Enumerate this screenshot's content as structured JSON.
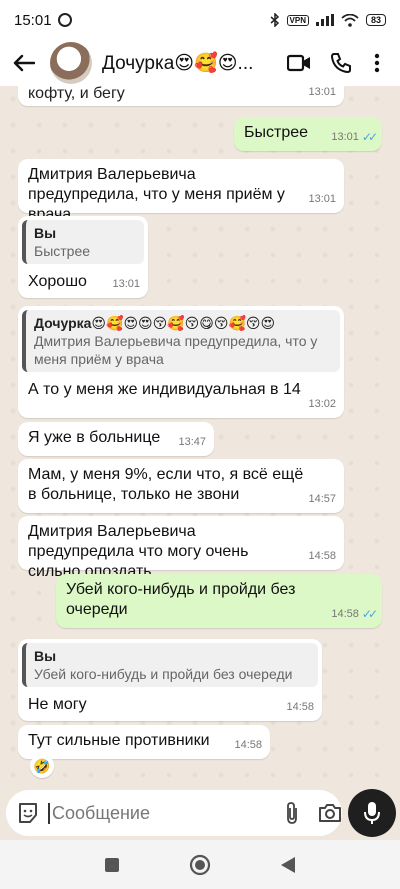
{
  "status_bar": {
    "time": "15:01",
    "vpn": "VPN",
    "battery": "83"
  },
  "header": {
    "contact_name": "Дочурка😍🥰😍..."
  },
  "messages": [
    {
      "text": "кофту, и бегу",
      "time": "13:01"
    },
    {
      "text": "Быстрее",
      "time": "13:01"
    },
    {
      "text": "Дмитрия  Валерьевича предупредила, что у меня приём у врача",
      "time": "13:01"
    },
    {
      "quote_name": "Вы",
      "quote_text": "Быстрее",
      "text": "Хорошо",
      "time": "13:01"
    },
    {
      "quote_name": "Дочурка😍🥰😍😍😚🥰😚😋😚🥰😚😍",
      "quote_text": "Дмитрия  Валерьевича предупредила, что у меня приём у врача",
      "text": "А то у меня же индивидуальная в 14",
      "time": "13:02"
    },
    {
      "text": "Я уже в больнице",
      "time": "13:47"
    },
    {
      "text": "Мам, у меня 9%, если что, я всё ещё в больнице, только не звони",
      "time": "14:57"
    },
    {
      "text": "Дмитрия Валерьевича предупредила что могу очень сильно опоздать",
      "time": "14:58"
    },
    {
      "text": "Убей кого-нибудь и пройди без очереди",
      "time": "14:58"
    },
    {
      "quote_name": "Вы",
      "quote_text": "Убей кого-нибудь и пройди без очереди",
      "text": "Не могу",
      "time": "14:58"
    },
    {
      "text": "Тут сильные противники",
      "time": "14:58",
      "reaction": "🤣"
    }
  ],
  "input": {
    "placeholder": "Сообщение"
  },
  "colors": {
    "outgoing": "#dcf8c6",
    "incoming": "#ffffff",
    "read_ticks": "#4fa3e0"
  }
}
